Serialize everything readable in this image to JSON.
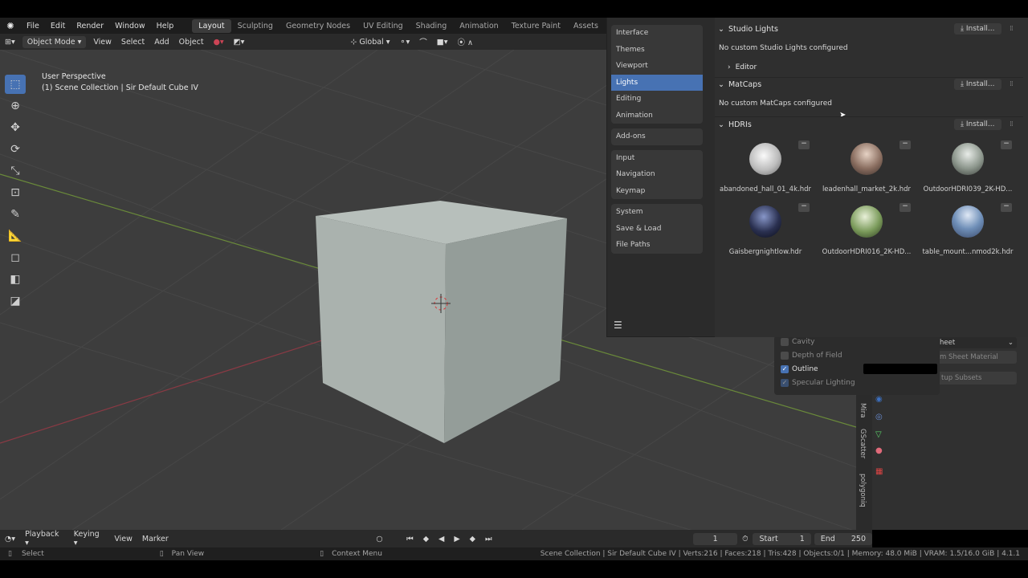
{
  "menubar": {
    "items": [
      "File",
      "Edit",
      "Render",
      "Window",
      "Help"
    ],
    "workspaces": [
      "Layout",
      "Sculpting",
      "Geometry Nodes",
      "UV Editing",
      "Shading",
      "Animation",
      "Texture Paint",
      "Assets"
    ],
    "active_workspace": "Layout",
    "add_tab": "+"
  },
  "viewport_header": {
    "mode": "Object Mode",
    "menus": [
      "View",
      "Select",
      "Add",
      "Object"
    ],
    "orientation": "Global"
  },
  "viewport": {
    "perspective_label": "User Perspective",
    "collection_label": "(1) Scene Collection | Sir Default Cube IV"
  },
  "overlay_popover": {
    "rows": [
      {
        "label": "Cavity",
        "checked": false
      },
      {
        "label": "Depth of Field",
        "checked": false
      },
      {
        "label": "Outline",
        "checked": true
      },
      {
        "label": "Specular Lighting",
        "checked": true
      }
    ]
  },
  "right_panel": {
    "dropdown_partial": "heet",
    "button1": "m Sheet Material",
    "button2": "tup Subsets",
    "tabs": [
      "Mira",
      "GScatter",
      "polygoniq"
    ]
  },
  "preferences": {
    "nav_groups": [
      [
        "Interface",
        "Themes",
        "Viewport",
        "Lights",
        "Editing",
        "Animation"
      ],
      [
        "Add-ons"
      ],
      [
        "Input",
        "Navigation",
        "Keymap"
      ],
      [
        "System",
        "Save & Load",
        "File Paths"
      ]
    ],
    "active_nav": "Lights",
    "studio_lights": {
      "title": "Studio Lights",
      "install": "Install...",
      "empty": "No custom Studio Lights configured",
      "editor": "Editor"
    },
    "matcaps": {
      "title": "MatCaps",
      "install": "Install...",
      "empty": "No custom MatCaps configured"
    },
    "hdris": {
      "title": "HDRIs",
      "install": "Install...",
      "items": [
        "abandoned_hall_01_4k.hdr",
        "leadenhall_market_2k.hdr",
        "OutdoorHDRI039_2K-HD...",
        "Gaisbergnightlow.hdr",
        "OutdoorHDRI016_2K-HD...",
        "table_mount...nmod2k.hdr"
      ]
    }
  },
  "timeline": {
    "menus": [
      "Playback",
      "Keying",
      "View",
      "Marker"
    ],
    "current_frame": "1",
    "start_label": "Start",
    "start": "1",
    "end_label": "End",
    "end": "250"
  },
  "statusbar": {
    "select": "Select",
    "pan": "Pan View",
    "context": "Context Menu",
    "info": "Scene Collection | Sir Default Cube IV | Verts:216 | Faces:218 | Tris:428 | Objects:0/1 | Memory: 48.0 MiB | VRAM: 1.5/16.0 GiB | 4.1.1"
  },
  "colors": {
    "accent": "#4772b3",
    "viewport_bg": "#3d3d3d",
    "cube_light": "#a9b1ad",
    "cube_dark": "#8f9894"
  }
}
